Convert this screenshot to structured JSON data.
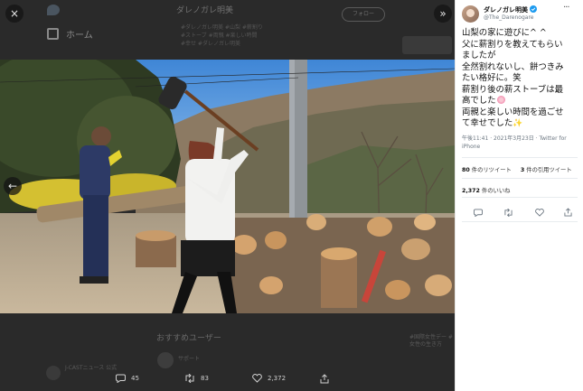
{
  "backdrop": {
    "home_label": "ホーム",
    "header_title": "ダレノガレ明美",
    "follow_label": "フォロー",
    "text_lines": [
      "#ダレノガレ明美 #山梨 #薪割り",
      "#ストーブ #両親 #楽しい時間",
      "#幸せ #ダレノガレ明美"
    ],
    "recommended_title": "おすすめユーザー",
    "recommended_name": "サポート",
    "lower_account": "J-CASTニュース 公式",
    "side_text": "#国際女性デー #女性の生き方"
  },
  "lightbox": {
    "close_icon": "×",
    "collapse_icon": "»",
    "prev_icon": "←"
  },
  "actions": {
    "replies": "45",
    "retweets": "83",
    "likes": "2,372"
  },
  "tweet": {
    "display_name": "ダレノガレ明美",
    "verified": true,
    "handle": "@The_Darenogare",
    "more": "···",
    "lines": [
      "山梨の家に遊びに^ ^",
      "父に薪割りを教えてもらい",
      "ましたが",
      "全然割れないし、餅つきみ",
      "たい格好に。笑",
      "薪割り後の薪ストーブは最",
      "高でした",
      "両親と楽しい時間を過ごせ",
      "て幸せでした"
    ],
    "time": "午後11:41 · 2021年3月23日 · Twitter for",
    "client": "iPhone",
    "retweet_count": "80",
    "retweet_label": " 件のリツイート",
    "quote_count": "3",
    "quote_label": " 件の引用ツイート",
    "like_count": "2,372",
    "like_label": " 件のいいね"
  }
}
